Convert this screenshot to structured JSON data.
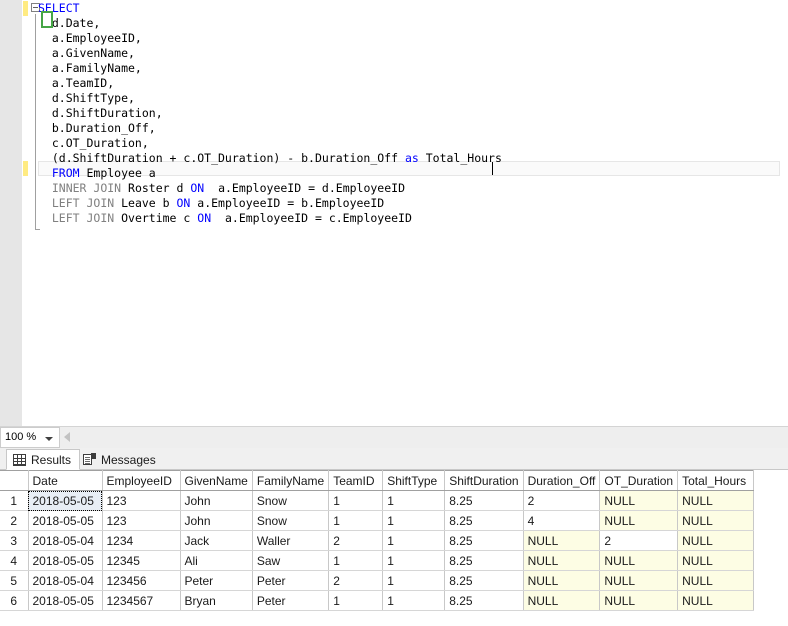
{
  "editor": {
    "lines": [
      [
        {
          "t": "SELECT",
          "c": "kw"
        }
      ],
      [
        {
          "t": "  d.Date,",
          "c": "plain"
        }
      ],
      [
        {
          "t": "  a.EmployeeID,",
          "c": "plain"
        }
      ],
      [
        {
          "t": "  a.GivenName,",
          "c": "plain"
        }
      ],
      [
        {
          "t": "  a.FamilyName,",
          "c": "plain"
        }
      ],
      [
        {
          "t": "  a.TeamID,",
          "c": "plain"
        }
      ],
      [
        {
          "t": "  d.ShiftType,",
          "c": "plain"
        }
      ],
      [
        {
          "t": "  d.ShiftDuration,",
          "c": "plain"
        }
      ],
      [
        {
          "t": "  b.Duration_Off,",
          "c": "plain"
        }
      ],
      [
        {
          "t": "  c.OT_Duration,",
          "c": "plain"
        }
      ],
      [
        {
          "t": "  (d.ShiftDuration + c.OT_Duration) - b.Duration_Off ",
          "c": "plain"
        },
        {
          "t": "as",
          "c": "kw"
        },
        {
          "t": " Total_Hours",
          "c": "plain"
        }
      ],
      [
        {
          "t": "  ",
          "c": "plain"
        },
        {
          "t": "FROM",
          "c": "kw"
        },
        {
          "t": " Employee a",
          "c": "plain"
        }
      ],
      [
        {
          "t": "  ",
          "c": "plain"
        },
        {
          "t": "INNER JOIN",
          "c": "gray"
        },
        {
          "t": " Roster d ",
          "c": "plain"
        },
        {
          "t": "ON",
          "c": "kw"
        },
        {
          "t": "  a.EmployeeID = d.EmployeeID",
          "c": "plain"
        }
      ],
      [
        {
          "t": "  ",
          "c": "plain"
        },
        {
          "t": "LEFT JOIN",
          "c": "gray"
        },
        {
          "t": " Leave b ",
          "c": "plain"
        },
        {
          "t": "ON",
          "c": "kw"
        },
        {
          "t": " a.EmployeeID = b.EmployeeID",
          "c": "plain"
        }
      ],
      [
        {
          "t": "  ",
          "c": "plain"
        },
        {
          "t": "LEFT JOIN",
          "c": "gray"
        },
        {
          "t": " Overtime c ",
          "c": "plain"
        },
        {
          "t": "ON",
          "c": "kw"
        },
        {
          "t": "  a.EmployeeID = c.EmployeeID",
          "c": "plain"
        }
      ]
    ],
    "colors": {
      "keyword": "#0000ff",
      "clause_gray": "#808080",
      "text": "#000000",
      "change_bar": "#ffeb82",
      "annotation_box": "#46a546",
      "current_line_bg": "#fafafa"
    }
  },
  "zoom_bar": {
    "zoom_value": "100 %"
  },
  "results": {
    "tabs": [
      {
        "label": "Results",
        "icon": "grid-icon",
        "active": true
      },
      {
        "label": "Messages",
        "icon": "page-icon",
        "active": false
      }
    ],
    "grid": {
      "row_header_label": "",
      "columns": [
        "Date",
        "EmployeeID",
        "GivenName",
        "FamilyName",
        "TeamID",
        "ShiftType",
        "ShiftDuration",
        "Duration_Off",
        "OT_Duration",
        "Total_Hours"
      ],
      "rows": [
        {
          "n": "1",
          "cells": [
            "2018-05-05",
            "123",
            "John",
            "Snow",
            "1",
            "1",
            "8.25",
            "2",
            "NULL",
            "NULL"
          ]
        },
        {
          "n": "2",
          "cells": [
            "2018-05-05",
            "123",
            "John",
            "Snow",
            "1",
            "1",
            "8.25",
            "4",
            "NULL",
            "NULL"
          ]
        },
        {
          "n": "3",
          "cells": [
            "2018-05-04",
            "1234",
            "Jack",
            "Waller",
            "2",
            "1",
            "8.25",
            "NULL",
            "2",
            "NULL"
          ]
        },
        {
          "n": "4",
          "cells": [
            "2018-05-05",
            "12345",
            "Ali",
            "Saw",
            "1",
            "1",
            "8.25",
            "NULL",
            "NULL",
            "NULL"
          ]
        },
        {
          "n": "5",
          "cells": [
            "2018-05-04",
            "123456",
            "Peter",
            "Peter",
            "2",
            "1",
            "8.25",
            "NULL",
            "NULL",
            "NULL"
          ]
        },
        {
          "n": "6",
          "cells": [
            "2018-05-05",
            "1234567",
            "Bryan",
            "Peter",
            "1",
            "1",
            "8.25",
            "NULL",
            "NULL",
            "NULL"
          ]
        }
      ],
      "selected_cell": {
        "row": 0,
        "col": 0
      },
      "null_cell_bg": "#fdfde4",
      "selected_cell_bg": "#e8eef5"
    }
  }
}
